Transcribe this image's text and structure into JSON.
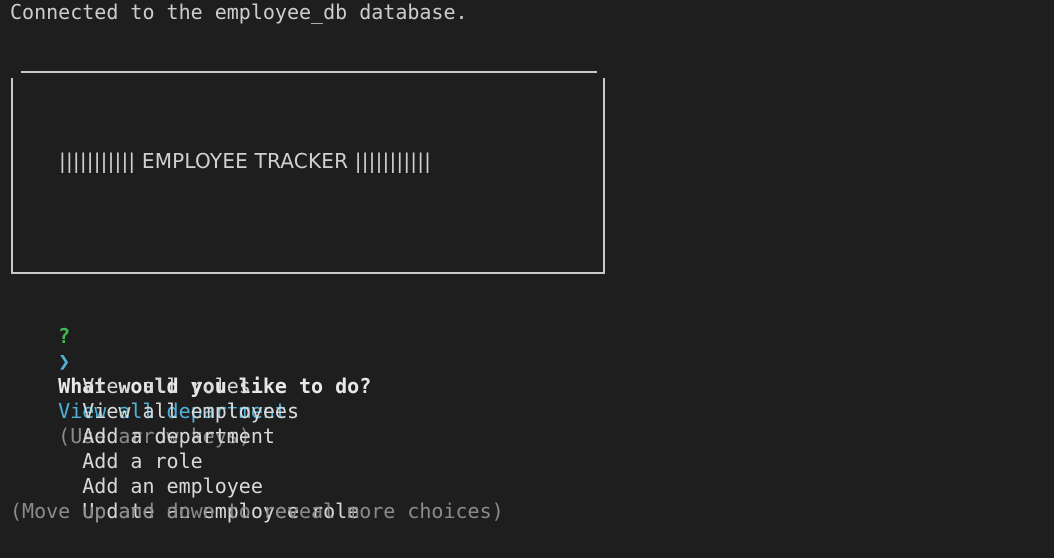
{
  "connection_message": "Connected to the employee_db database.",
  "banner": {
    "title": "||||||||||| EMPLOYEE TRACKER |||||||||||"
  },
  "prompt": {
    "marker": "?",
    "question": "What would you like to do?",
    "hint": "(Use arrow keys)",
    "pointer": "❯",
    "choices": [
      {
        "label": "View all departments",
        "selected": true
      },
      {
        "label": "View all roles",
        "selected": false
      },
      {
        "label": "View all employees",
        "selected": false
      },
      {
        "label": "Add a department",
        "selected": false
      },
      {
        "label": "Add a role",
        "selected": false
      },
      {
        "label": "Add an employee",
        "selected": false
      },
      {
        "label": "Update an employee role",
        "selected": false
      }
    ],
    "more_hint": "(Move up and down to reveal more choices)"
  },
  "colors": {
    "background": "#1e1e1e",
    "text": "#cccccc",
    "question_marker": "#3fb950",
    "selected": "#4fb3d9",
    "muted": "#8a8a8a"
  }
}
